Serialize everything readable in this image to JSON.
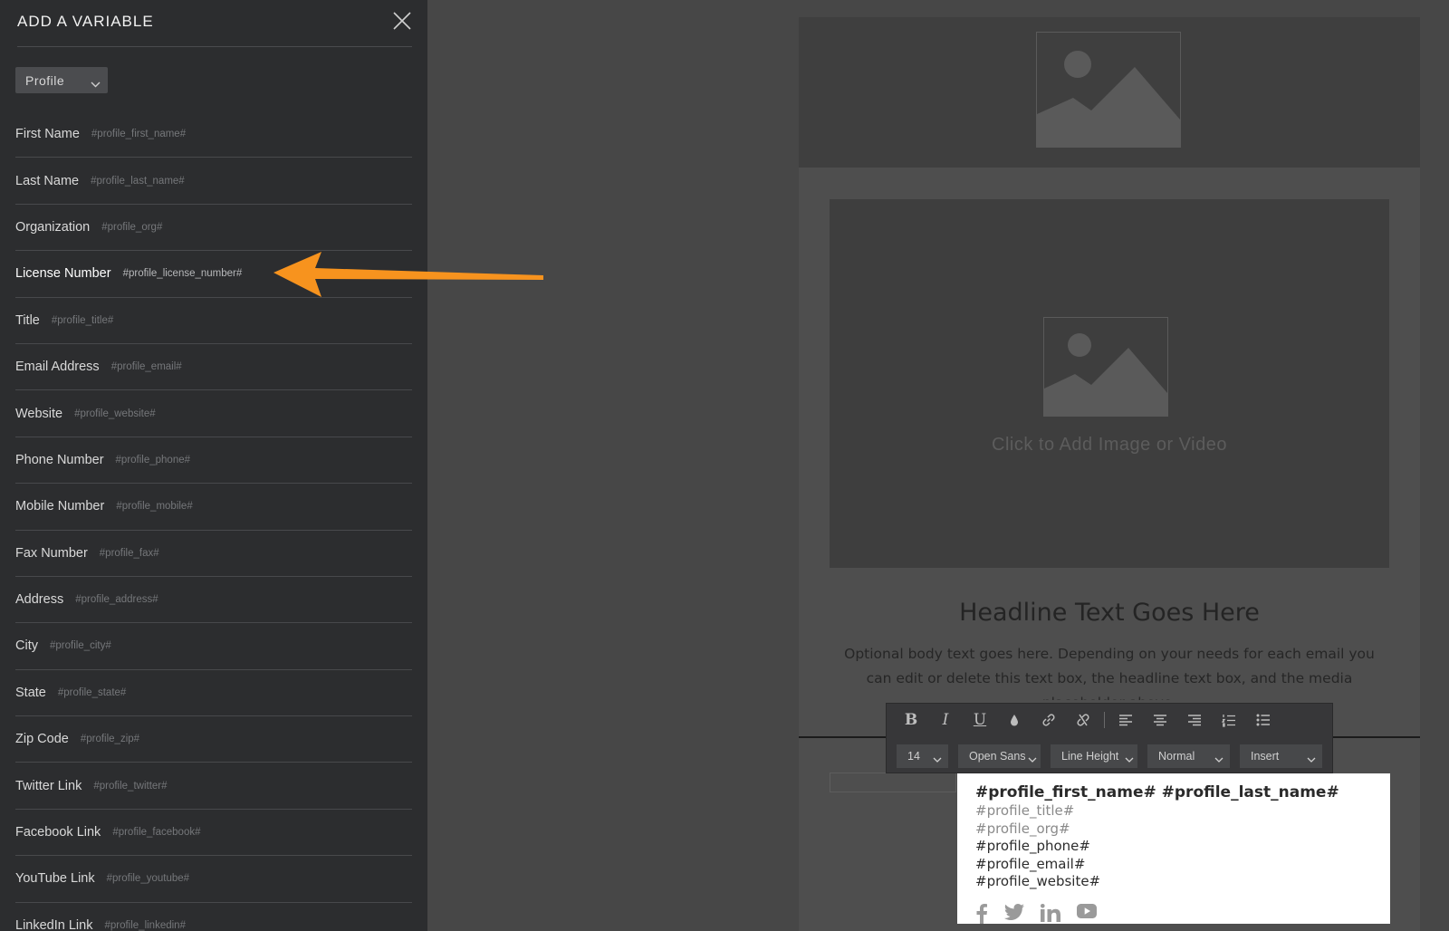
{
  "panel": {
    "title": "ADD A VARIABLE",
    "category_select": {
      "value": "Profile"
    },
    "variables": [
      {
        "label": "First Name",
        "token": "#profile_first_name#"
      },
      {
        "label": "Last Name",
        "token": "#profile_last_name#"
      },
      {
        "label": "Organization",
        "token": "#profile_org#"
      },
      {
        "label": "License Number",
        "token": "#profile_license_number#"
      },
      {
        "label": "Title",
        "token": "#profile_title#"
      },
      {
        "label": "Email Address",
        "token": "#profile_email#"
      },
      {
        "label": "Website",
        "token": "#profile_website#"
      },
      {
        "label": "Phone Number",
        "token": "#profile_phone#"
      },
      {
        "label": "Mobile Number",
        "token": "#profile_mobile#"
      },
      {
        "label": "Fax Number",
        "token": "#profile_fax#"
      },
      {
        "label": "Address",
        "token": "#profile_address#"
      },
      {
        "label": "City",
        "token": "#profile_city#"
      },
      {
        "label": "State",
        "token": "#profile_state#"
      },
      {
        "label": "Zip Code",
        "token": "#profile_zip#"
      },
      {
        "label": "Twitter Link",
        "token": "#profile_twitter#"
      },
      {
        "label": "Facebook Link",
        "token": "#profile_facebook#"
      },
      {
        "label": "YouTube Link",
        "token": "#profile_youtube#"
      },
      {
        "label": "LinkedIn Link",
        "token": "#profile_linkedin#"
      }
    ]
  },
  "email": {
    "media_caption": "Click to Add Image or Video",
    "headline": "Headline Text Goes Here",
    "body": "Optional body text goes here. Depending on your needs for each email you can edit or delete this text box, the headline text box, and the media placeholder above."
  },
  "toolbar": {
    "bold": "B",
    "italic": "I",
    "underline": "U",
    "font_size": "14",
    "font_family": "Open Sans",
    "line_height": "Line Height",
    "style": "Normal",
    "insert": "Insert"
  },
  "signature": {
    "name_line": "#profile_first_name# #profile_last_name#",
    "title": "#profile_title#",
    "org": "#profile_org#",
    "phone": "#profile_phone#",
    "email": "#profile_email#",
    "website": "#profile_website#"
  },
  "colors": {
    "arrow": "#f7931e",
    "sidebar_bg": "#2c2d2f",
    "canvas_bg": "#474747"
  }
}
